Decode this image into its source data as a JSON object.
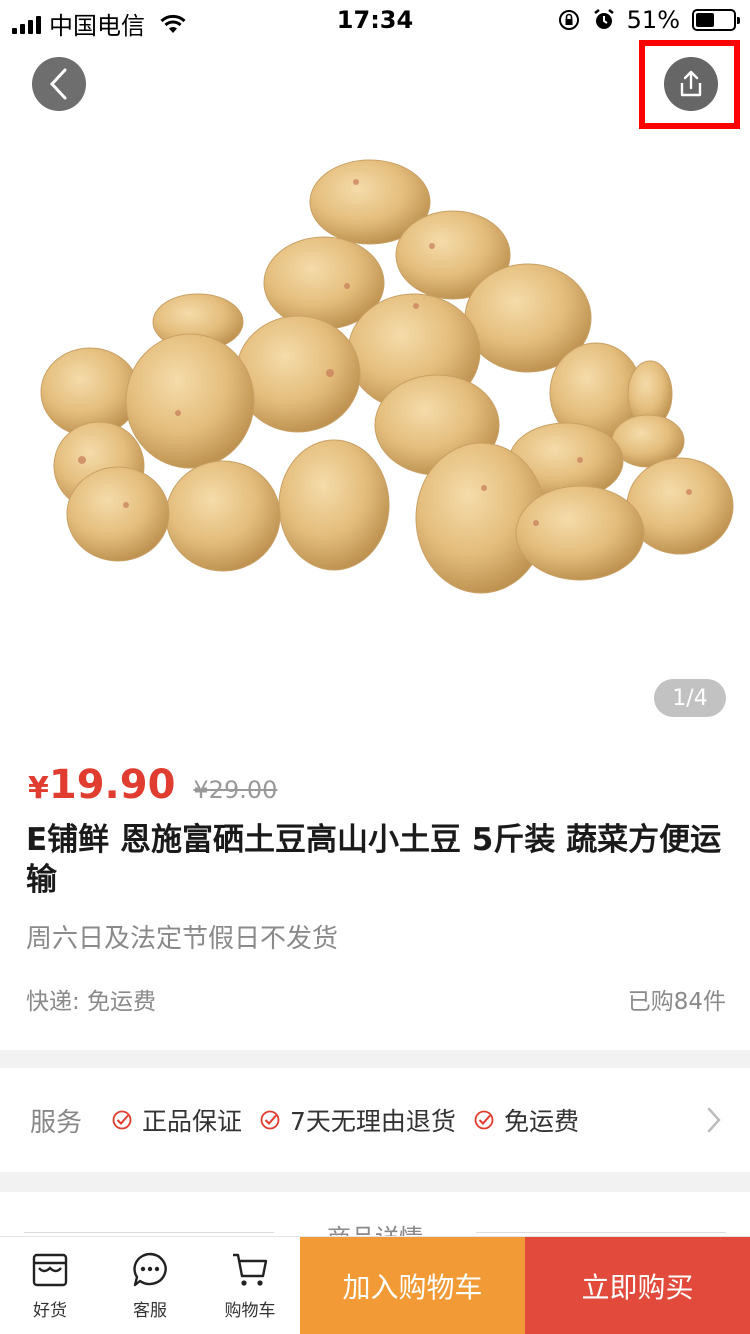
{
  "status_bar": {
    "carrier": "中国电信",
    "time": "17:34",
    "battery": "51%",
    "battery_level": 0.51
  },
  "nav": {
    "back_icon": "chevron-left-icon",
    "share_icon": "share-icon"
  },
  "gallery": {
    "counter": "1/4"
  },
  "product": {
    "price_symbol": "¥",
    "price": "19.90",
    "original_price": "¥29.00",
    "title": "E铺鲜 恩施富硒土豆高山小土豆 5斤装 蔬菜方便运输",
    "notice": "周六日及法定节假日不发货",
    "shipping": "快递: 免运费",
    "sold": "已购84件"
  },
  "services": {
    "label": "服务",
    "items": [
      "正品保证",
      "7天无理由退货",
      "免运费"
    ],
    "accent": "#e03c2f"
  },
  "details": {
    "title": "商品详情"
  },
  "bottom_bar": {
    "tabs": [
      {
        "label": "好货",
        "icon": "shop-icon"
      },
      {
        "label": "客服",
        "icon": "chat-icon"
      },
      {
        "label": "购物车",
        "icon": "cart-icon"
      }
    ],
    "add_to_cart": "加入购物车",
    "buy_now": "立即购买",
    "add_color": "#f29b36",
    "buy_color": "#e24a3b"
  }
}
